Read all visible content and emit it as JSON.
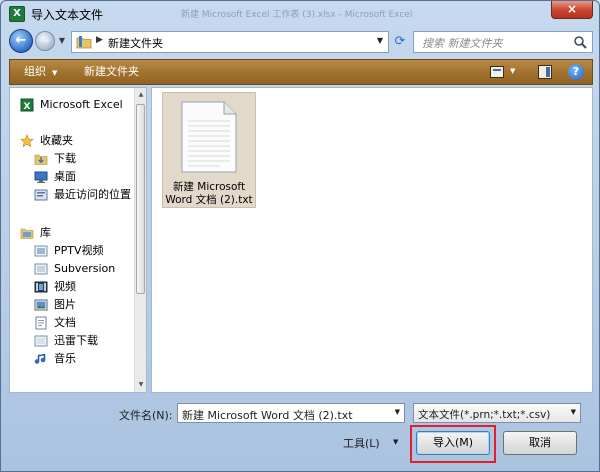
{
  "window": {
    "title": "导入文本文件",
    "background_title": "新建 Microsoft Excel 工作表 (3).xlsx - Microsoft Excel",
    "close_label": "×"
  },
  "address": {
    "path": "新建文件夹",
    "search_placeholder": "搜索 新建文件夹"
  },
  "toolbar": {
    "organize_label": "组织",
    "new_folder_label": "新建文件夹",
    "help_label": "?"
  },
  "sidebar": {
    "items": [
      {
        "label": "Microsoft Excel",
        "icon": "excel-icon"
      },
      {
        "label": "收藏夹",
        "icon": "star-icon"
      },
      {
        "label": "下载",
        "icon": "download-folder-icon"
      },
      {
        "label": "桌面",
        "icon": "desktop-icon"
      },
      {
        "label": "最近访问的位置",
        "icon": "recent-places-icon"
      },
      {
        "label": "库",
        "icon": "library-icon"
      },
      {
        "label": "PPTV视频",
        "icon": "pptv-library-icon"
      },
      {
        "label": "Subversion",
        "icon": "subversion-library-icon"
      },
      {
        "label": "视频",
        "icon": "video-library-icon"
      },
      {
        "label": "图片",
        "icon": "pictures-library-icon"
      },
      {
        "label": "文档",
        "icon": "documents-library-icon"
      },
      {
        "label": "迅雷下载",
        "icon": "thunder-download-icon"
      },
      {
        "label": "音乐",
        "icon": "music-library-icon"
      }
    ]
  },
  "files": [
    {
      "name_line1": "新建 Microsoft",
      "name_line2": "Word 文档 (2).txt",
      "icon": "text-file-icon"
    }
  ],
  "footer": {
    "filename_label": "文件名(N):",
    "filename_value": "新建 Microsoft Word 文档 (2).txt",
    "filter_value": "文本文件(*.prn;*.txt;*.csv)",
    "tools_label": "工具(L)",
    "import_label": "导入(M)",
    "cancel_label": "取消"
  },
  "colors": {
    "toolbar": "#a0712d",
    "focus_outline": "#e0202a",
    "selection": "#e2d9cb"
  }
}
